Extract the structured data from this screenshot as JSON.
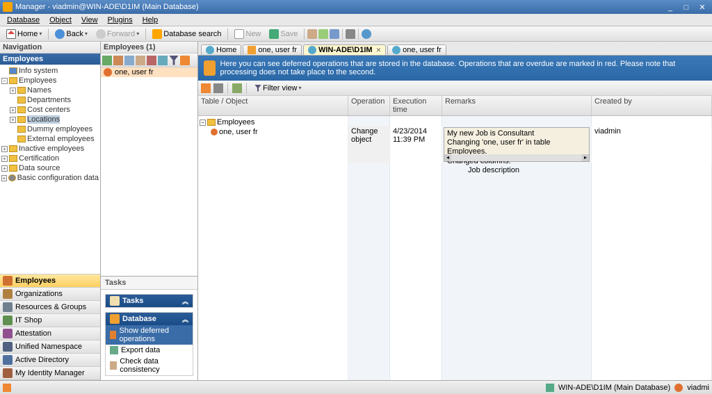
{
  "window": {
    "title": "Manager - viadmin@WIN-ADE\\D1IM (Main Database)"
  },
  "menu": {
    "database": "Database",
    "object": "Object",
    "view": "View",
    "plugins": "Plugins",
    "help": "Help"
  },
  "toolbar": {
    "home": "Home",
    "back": "Back",
    "forward": "Forward",
    "dbsearch": "Database search",
    "new": "New",
    "save": "Save"
  },
  "nav": {
    "title": "Navigation",
    "category": "Employees",
    "tree": {
      "infosystem": "Info system",
      "employees": "Employees",
      "names": "Names",
      "departments": "Departments",
      "costcenters": "Cost centers",
      "locations": "Locations",
      "dummyemp": "Dummy employees",
      "extemp": "External employees",
      "inactive": "Inactive employees",
      "certification": "Certification",
      "datasource": "Data source",
      "basicconfig": "Basic configuration data"
    }
  },
  "navbuttons": {
    "employees": "Employees",
    "organizations": "Organizations",
    "resources": "Resources & Groups",
    "itshop": "IT Shop",
    "attestation": "Attestation",
    "unified": "Unified Namespace",
    "ad": "Active Directory",
    "idm": "My Identity Manager"
  },
  "mid": {
    "title": "Employees (1)",
    "item": "one, user fr"
  },
  "tasks": {
    "title": "Tasks",
    "group_tasks": "Tasks",
    "group_database": "Database",
    "show_deferred": "Show deferred operations",
    "export": "Export data",
    "check": "Check data consistency"
  },
  "tabs": {
    "home": "Home",
    "one": "one, user fr",
    "winade": "WIN-ADE\\D1IM",
    "one2": "one, user fr"
  },
  "infobar": {
    "text": "Here you can see deferred operations that are stored in the database. Operations that are overdue are marked in red. Please note that processing does not take place to the second."
  },
  "filter": {
    "label": "Filter view"
  },
  "grid": {
    "cols": {
      "obj": "Table / Object",
      "op": "Operation",
      "ext": "Execution time",
      "rem": "Remarks",
      "cby": "Created by"
    },
    "groupname": "Employees",
    "rowname": "one, user fr",
    "row": {
      "operation": "Change object",
      "exectime": "4/23/2014 11:39 PM",
      "createdby": "viadmin",
      "remarks_l1": "My new Job is Consultant",
      "remarks_l2": "Changing 'one, user fr' in table Employees.",
      "remarks_l3": "Changed columns:",
      "remarks_l4": "Job description"
    }
  },
  "status": {
    "conn": "WIN-ADE\\D1IM (Main Database)",
    "user": "viadmi"
  }
}
